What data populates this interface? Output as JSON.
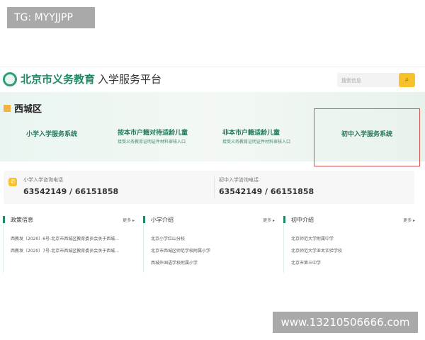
{
  "watermarks": {
    "top": "TG: MYYJJPP",
    "bottom": "www.13210506666.com"
  },
  "header": {
    "brand": "北京市义务教育",
    "subtitle": "入学服务平台",
    "search_placeholder": "搜索信息",
    "search_icon": "search-icon"
  },
  "district": "西城区",
  "cards": [
    {
      "title": "小学入学服务系统",
      "sub": ""
    },
    {
      "title": "按本市户籍对待适龄儿童",
      "sub": "接受义务教育证明证件材料审核入口"
    },
    {
      "title": "非本市户籍适龄儿童",
      "sub": "接受义务教育证明证件材料审核入口"
    },
    {
      "title": "初中入学服务系统",
      "sub": "",
      "highlighted": true
    }
  ],
  "highlight_color": "#d9534f",
  "phones": [
    {
      "label": "小学入学咨询电话",
      "number": "63542149 / 66151858"
    },
    {
      "label": "初中入学咨询电话",
      "number": "63542149 / 66151858"
    }
  ],
  "columns": [
    {
      "title": "政策信息",
      "more": "更多 ▸",
      "items": [
        "西教发〔2020〕6号-北京市西城区教育委员会关于西城...",
        "西教发〔2020〕7号-北京市西城区教育委员会关于西城..."
      ]
    },
    {
      "title": "小学介绍",
      "more": "更多 ▸",
      "items": [
        "北京小学红山分校",
        "北京市西城区师范学校附属小学",
        "西城外国语学校附属小学"
      ]
    },
    {
      "title": "初中介绍",
      "more": "更多 ▸",
      "items": [
        "北京师范大学附属中学",
        "北京师范大学亚太实验学校",
        "北京市第三中学"
      ]
    }
  ]
}
